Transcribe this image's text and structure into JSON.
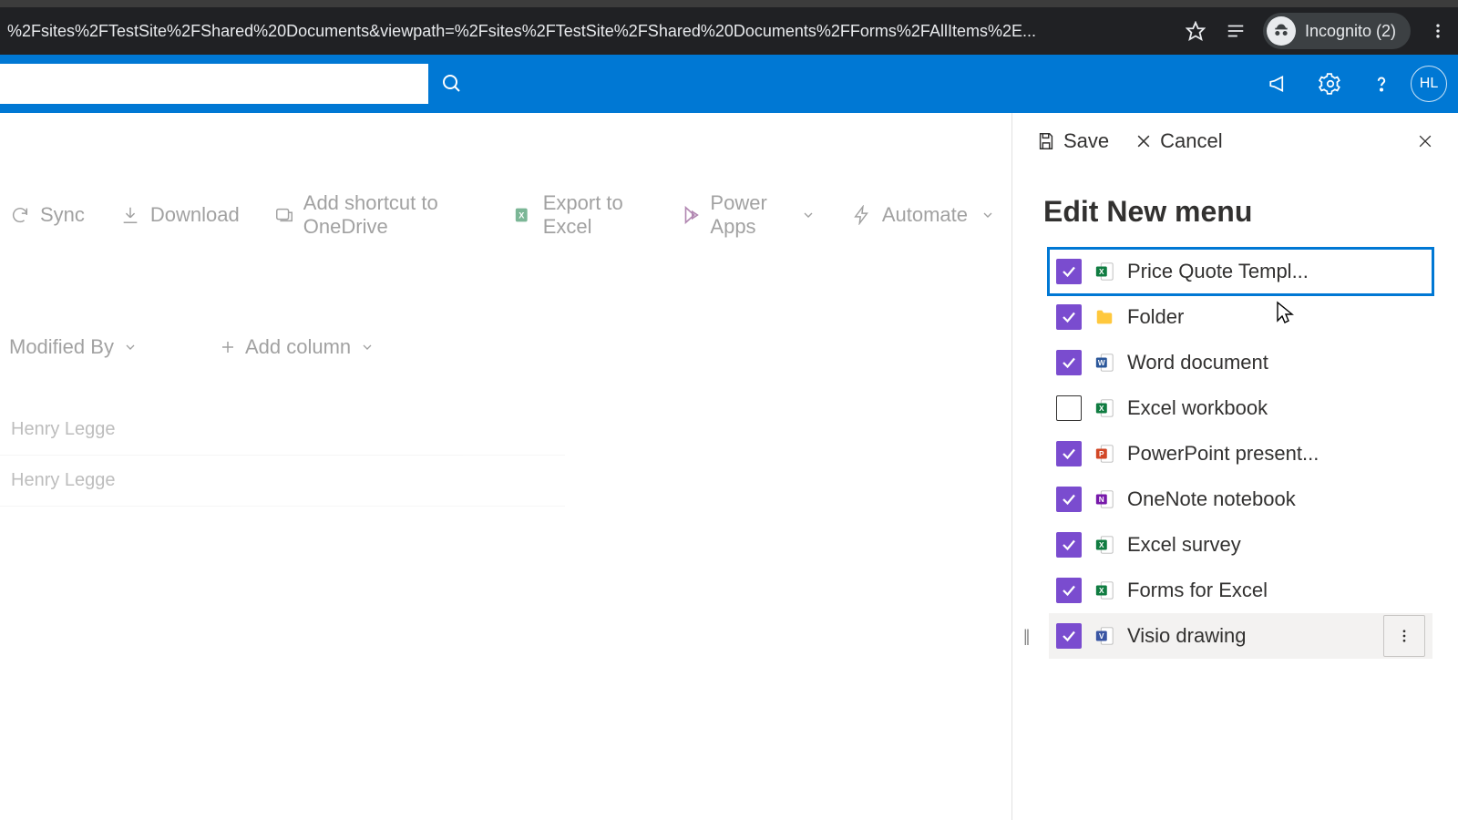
{
  "browser": {
    "url": "%2Fsites%2FTestSite%2FShared%20Documents&viewpath=%2Fsites%2FTestSite%2FShared%20Documents%2FForms%2FAllItems%2E...",
    "incognito_label": "Incognito (2)"
  },
  "suite": {
    "search_placeholder": "",
    "avatar_initials": "HL"
  },
  "toolbar": {
    "sync": "Sync",
    "download": "Download",
    "add_shortcut": "Add shortcut to OneDrive",
    "export_excel": "Export to Excel",
    "power_apps": "Power Apps",
    "automate": "Automate"
  },
  "columns": {
    "modified_by": "Modified By",
    "add_column": "Add column"
  },
  "rows": [
    {
      "modified_by": "Henry Legge"
    },
    {
      "modified_by": "Henry Legge"
    }
  ],
  "panel": {
    "save": "Save",
    "cancel": "Cancel",
    "title": "Edit New menu",
    "items": [
      {
        "label": "Price Quote Templ...",
        "checked": true,
        "icon": "excel",
        "selected": true
      },
      {
        "label": "Folder",
        "checked": true,
        "icon": "folder"
      },
      {
        "label": "Word document",
        "checked": true,
        "icon": "word"
      },
      {
        "label": "Excel workbook",
        "checked": false,
        "icon": "excel"
      },
      {
        "label": "PowerPoint present...",
        "checked": true,
        "icon": "powerpoint"
      },
      {
        "label": "OneNote notebook",
        "checked": true,
        "icon": "onenote"
      },
      {
        "label": "Excel survey",
        "checked": true,
        "icon": "excel"
      },
      {
        "label": "Forms for Excel",
        "checked": true,
        "icon": "excel"
      },
      {
        "label": "Visio drawing",
        "checked": true,
        "icon": "visio",
        "hovered": true,
        "drag": true,
        "more": true
      }
    ]
  }
}
